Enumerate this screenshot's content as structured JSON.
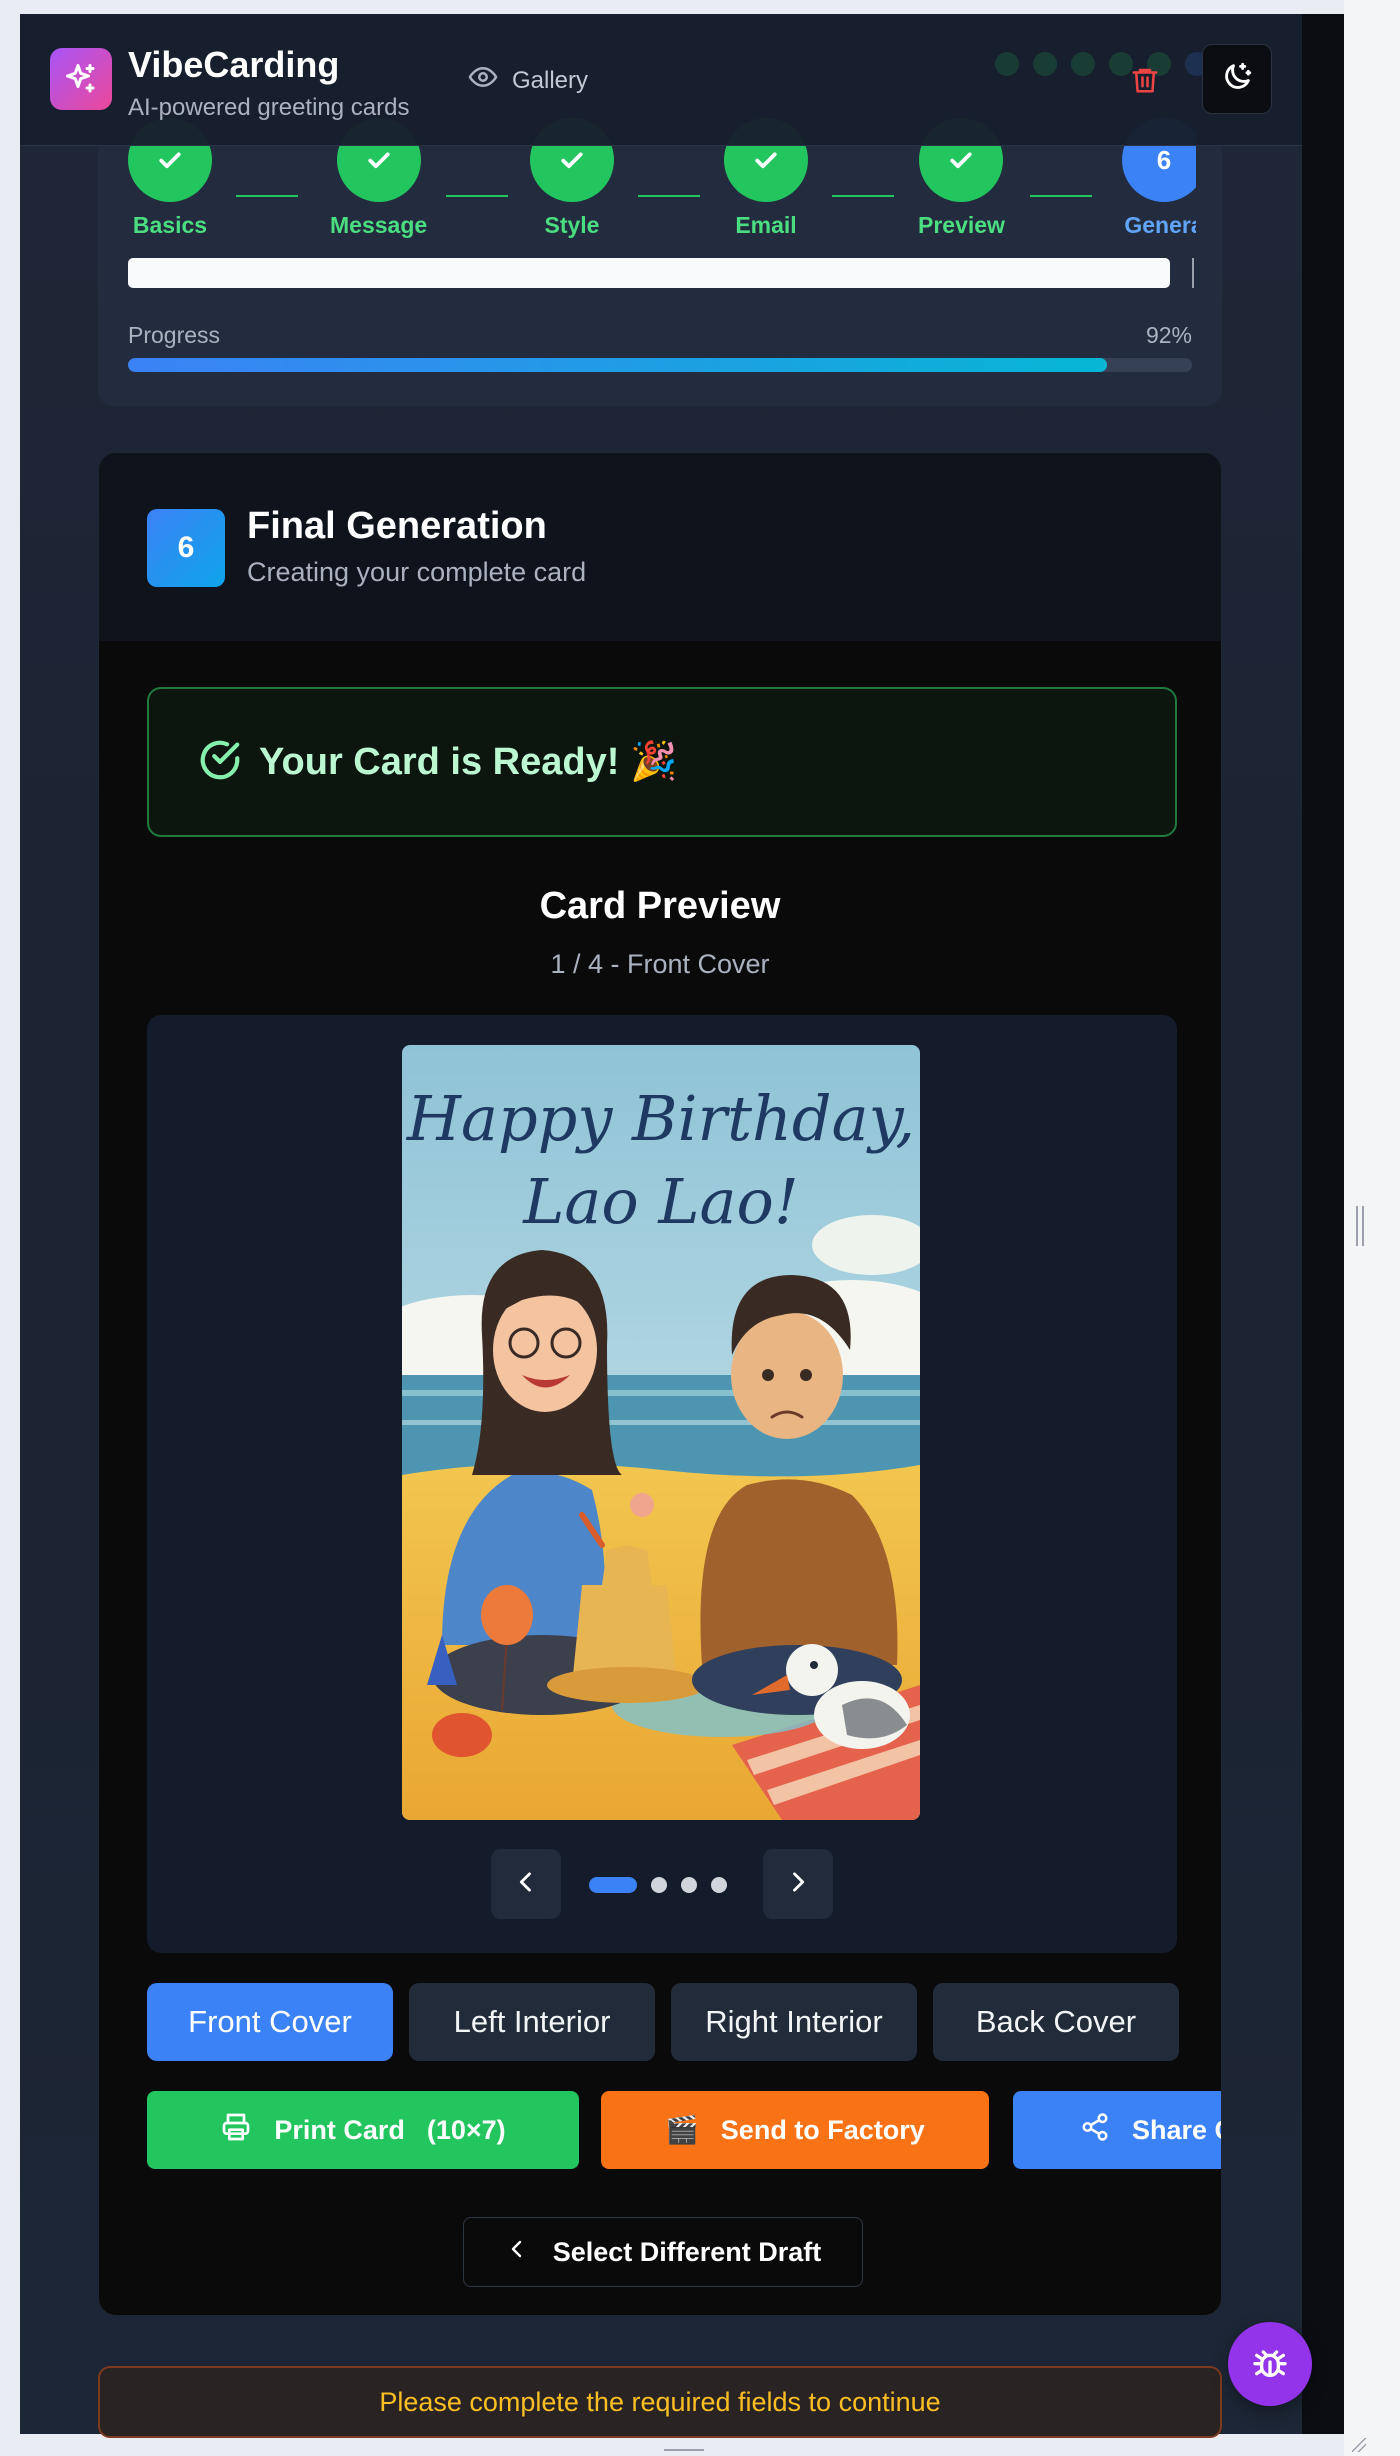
{
  "header": {
    "app_title": "VibeCarding",
    "app_subtitle": "AI-powered greeting cards",
    "gallery_label": "Gallery"
  },
  "steps": [
    {
      "label": "Basics",
      "state": "complete"
    },
    {
      "label": "Message",
      "state": "complete"
    },
    {
      "label": "Style",
      "state": "complete"
    },
    {
      "label": "Email",
      "state": "complete"
    },
    {
      "label": "Preview",
      "state": "complete"
    },
    {
      "label": "Genera",
      "number": "6",
      "state": "current"
    }
  ],
  "progress": {
    "label": "Progress",
    "percent_text": "92%",
    "value": 0.92
  },
  "main": {
    "step_number": "6",
    "title": "Final Generation",
    "subtitle": "Creating your complete card",
    "ready_message": "Your Card is Ready! 🎉",
    "preview_title": "Card Preview",
    "preview_position": "1 / 4 - Front Cover",
    "card_image": {
      "headline_line1": "Happy Birthday,",
      "headline_line2": "Lao Lao!"
    },
    "carousel": {
      "current": 1,
      "total": 4
    },
    "face_tabs": [
      "Front Cover",
      "Left Interior",
      "Right Interior",
      "Back Cover"
    ],
    "actions": {
      "print": "Print Card",
      "print_size": "(10×7)",
      "factory_emoji": "🎬",
      "factory": "Send to Factory",
      "share": "Share Card"
    },
    "select_draft": "Select Different Draft"
  },
  "footer": {
    "warning": "Please complete the required fields to continue"
  },
  "colors": {
    "accent_blue": "#3b82f6",
    "success_green": "#22c55e",
    "factory_orange": "#f97316",
    "warning_text": "#fbbf24",
    "bug_purple": "#9333ea"
  },
  "icons": [
    "sparkles-icon",
    "eye-icon",
    "trash-icon",
    "moon-stars-icon",
    "check-icon",
    "check-circle-icon",
    "chevron-left-icon",
    "chevron-right-icon",
    "printer-icon",
    "share-icon",
    "bug-icon"
  ]
}
